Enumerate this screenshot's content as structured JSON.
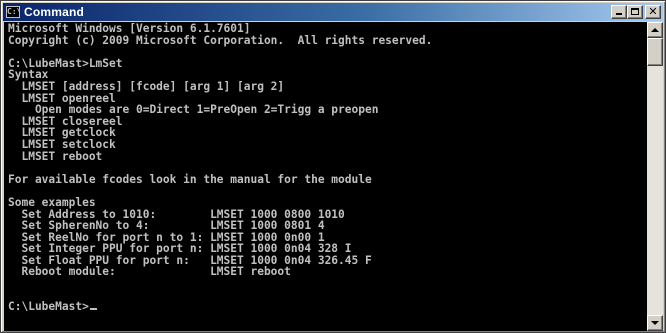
{
  "window": {
    "title": "Command",
    "icon_label": "C:\\"
  },
  "console": {
    "lines": [
      "Microsoft Windows [Version 6.1.7601]",
      "Copyright (c) 2009 Microsoft Corporation.  All rights reserved.",
      "",
      "C:\\LubeMast>LmSet",
      "Syntax",
      "  LMSET [address] [fcode] [arg 1] [arg 2]",
      "  LMSET openreel",
      "    Open modes are 0=Direct 1=PreOpen 2=Trigg a preopen",
      "  LMSET closereel",
      "  LMSET getclock",
      "  LMSET setclock",
      "  LMSET reboot",
      "",
      "For available fcodes look in the manual for the module",
      "",
      "Some examples",
      "  Set Address to 1010:        LMSET 1000 0800 1010",
      "  Set SpherenNo to 4:         LMSET 1000 0801 4",
      "  Set ReelNo for port n to 1: LMSET 1000 0n00 1",
      "  Set Integer PPU for port n: LMSET 1000 0n04 328 I",
      "  Set Float PPU for port n:   LMSET 1000 0n04 326.45 F",
      "  Reboot module:              LMSET reboot",
      "",
      "",
      "C:\\LubeMast>"
    ]
  },
  "colors": {
    "console_bg": "#000000",
    "console_fg": "#c0c0c0",
    "title_start": "#0a246a",
    "title_end": "#a6caf0"
  },
  "icons": {
    "app": "console-icon",
    "minimize": "minimize-icon",
    "maximize": "maximize-icon",
    "close": "close-icon",
    "scroll_up": "arrow-up-icon",
    "scroll_down": "arrow-down-icon"
  }
}
